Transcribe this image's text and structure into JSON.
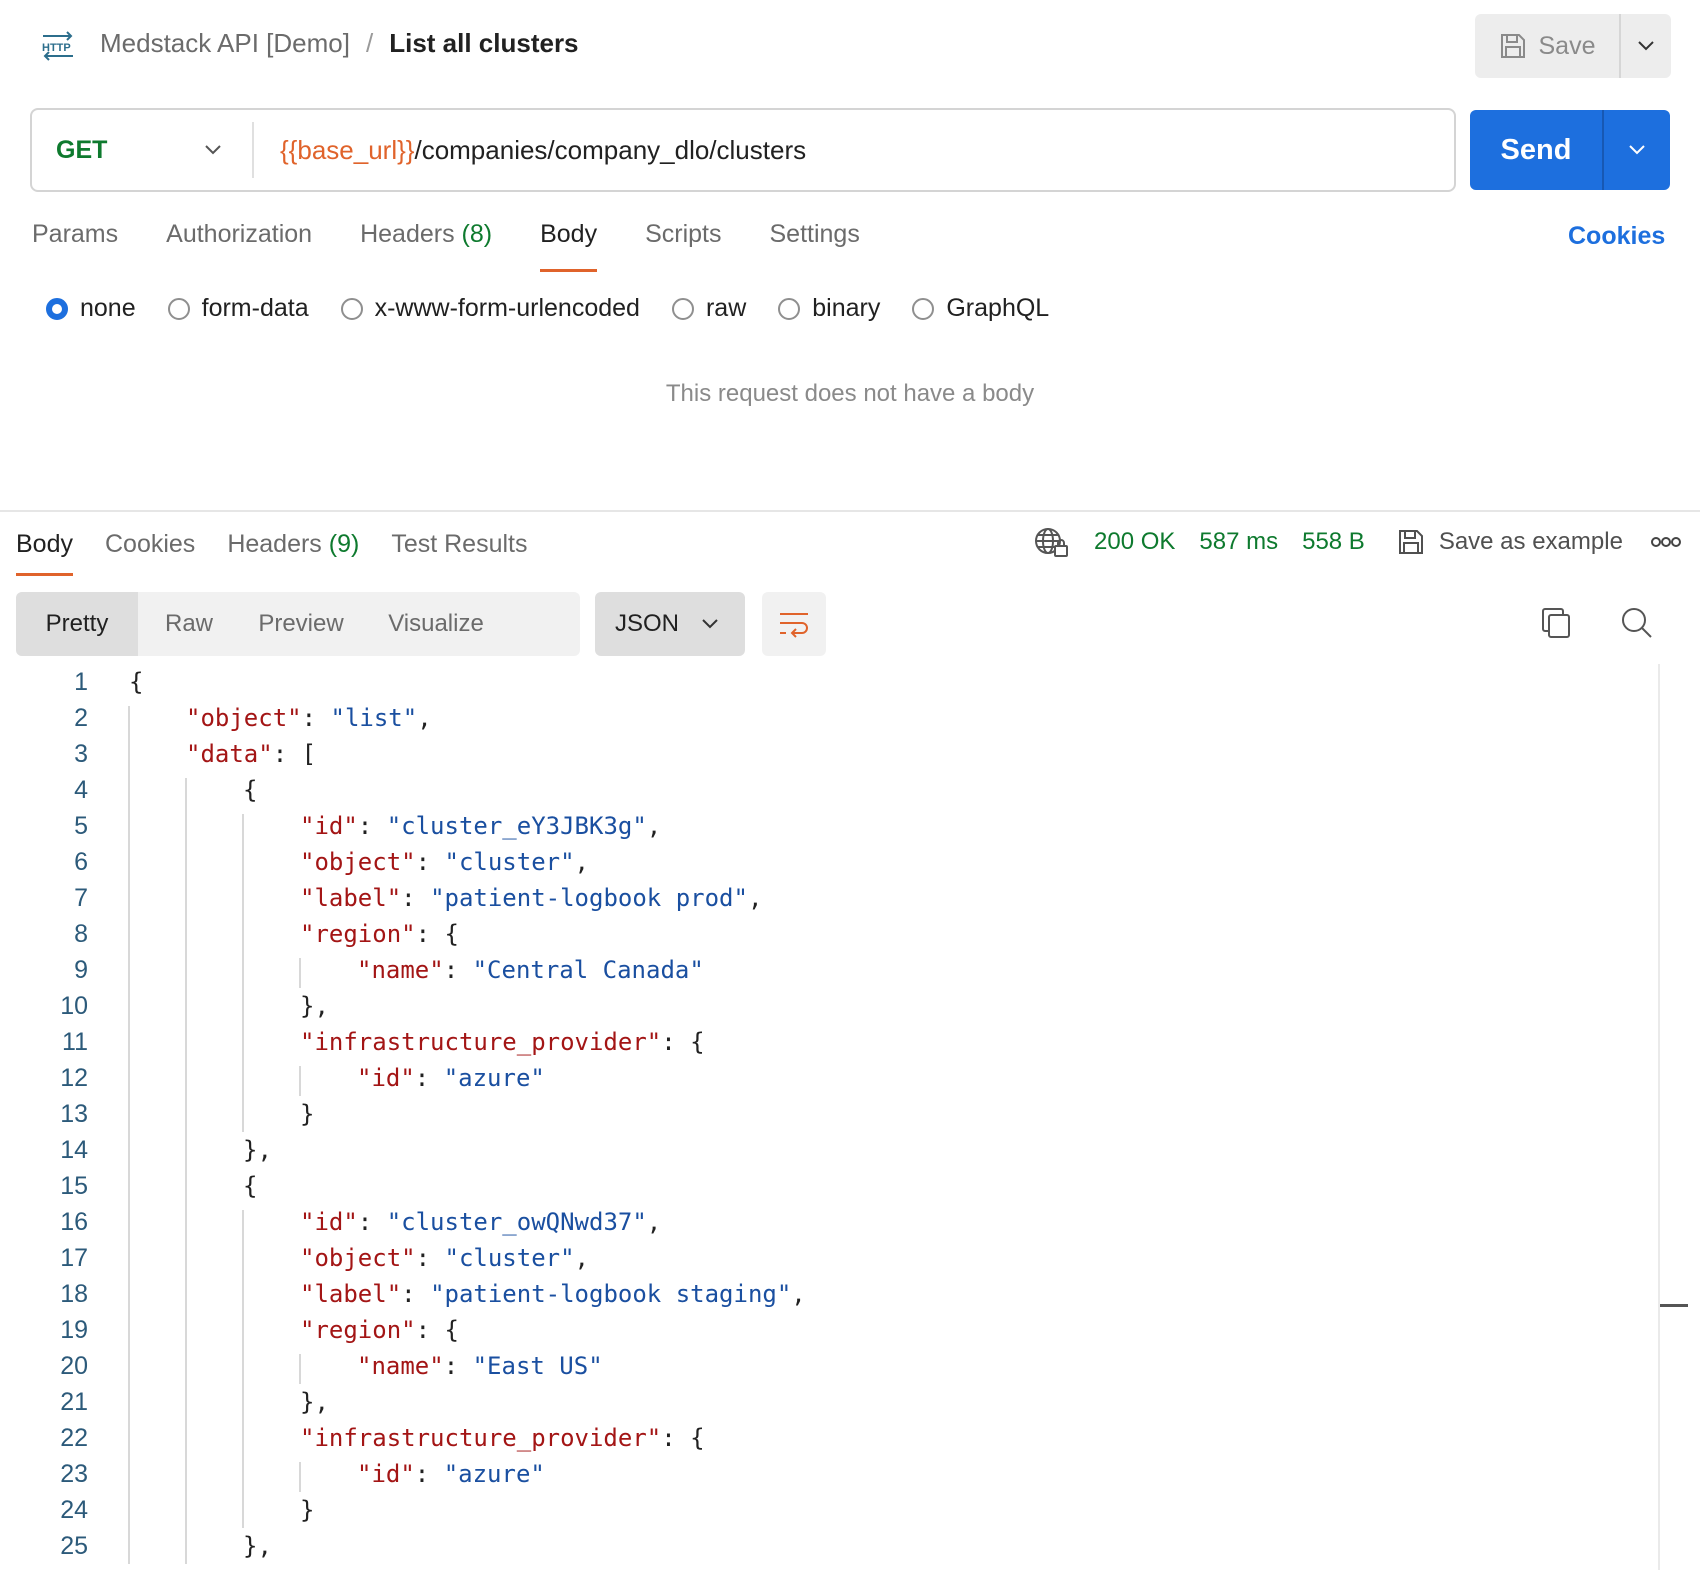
{
  "header": {
    "icon": "http-icon",
    "collection": "Medstack API [Demo]",
    "separator": "/",
    "request_name": "List all clusters",
    "save_label": "Save"
  },
  "request": {
    "method": "GET",
    "url_variable": "{{base_url}}",
    "url_path": "/companies/company_dlo/clusters",
    "send_label": "Send",
    "tabs": [
      {
        "label": "Params",
        "count": ""
      },
      {
        "label": "Authorization",
        "count": ""
      },
      {
        "label": "Headers",
        "count": "(8)"
      },
      {
        "label": "Body",
        "count": ""
      },
      {
        "label": "Scripts",
        "count": ""
      },
      {
        "label": "Settings",
        "count": ""
      }
    ],
    "active_tab": "Body",
    "cookies_link": "Cookies",
    "body_types": [
      "none",
      "form-data",
      "x-www-form-urlencoded",
      "raw",
      "binary",
      "GraphQL"
    ],
    "selected_body_type": "none",
    "empty_body_message": "This request does not have a body"
  },
  "response": {
    "tabs": [
      {
        "label": "Body",
        "count": ""
      },
      {
        "label": "Cookies",
        "count": ""
      },
      {
        "label": "Headers",
        "count": "(9)"
      },
      {
        "label": "Test Results",
        "count": ""
      }
    ],
    "active_tab": "Body",
    "status": "200 OK",
    "time": "587 ms",
    "size": "558 B",
    "save_example_label": "Save as example",
    "view_modes": [
      "Pretty",
      "Raw",
      "Preview",
      "Visualize"
    ],
    "active_view": "Pretty",
    "format": "JSON",
    "code_lines": [
      [
        {
          "t": "p",
          "v": "{"
        }
      ],
      [
        {
          "t": "k",
          "v": "\"object\""
        },
        {
          "t": "p",
          "v": ": "
        },
        {
          "t": "s",
          "v": "\"list\""
        },
        {
          "t": "p",
          "v": ","
        }
      ],
      [
        {
          "t": "k",
          "v": "\"data\""
        },
        {
          "t": "p",
          "v": ": ["
        }
      ],
      [
        {
          "t": "p",
          "v": "{"
        }
      ],
      [
        {
          "t": "k",
          "v": "\"id\""
        },
        {
          "t": "p",
          "v": ": "
        },
        {
          "t": "s",
          "v": "\"cluster_eY3JBK3g\""
        },
        {
          "t": "p",
          "v": ","
        }
      ],
      [
        {
          "t": "k",
          "v": "\"object\""
        },
        {
          "t": "p",
          "v": ": "
        },
        {
          "t": "s",
          "v": "\"cluster\""
        },
        {
          "t": "p",
          "v": ","
        }
      ],
      [
        {
          "t": "k",
          "v": "\"label\""
        },
        {
          "t": "p",
          "v": ": "
        },
        {
          "t": "s",
          "v": "\"patient-logbook prod\""
        },
        {
          "t": "p",
          "v": ","
        }
      ],
      [
        {
          "t": "k",
          "v": "\"region\""
        },
        {
          "t": "p",
          "v": ": {"
        }
      ],
      [
        {
          "t": "k",
          "v": "\"name\""
        },
        {
          "t": "p",
          "v": ": "
        },
        {
          "t": "s",
          "v": "\"Central Canada\""
        }
      ],
      [
        {
          "t": "p",
          "v": "},"
        }
      ],
      [
        {
          "t": "k",
          "v": "\"infrastructure_provider\""
        },
        {
          "t": "p",
          "v": ": {"
        }
      ],
      [
        {
          "t": "k",
          "v": "\"id\""
        },
        {
          "t": "p",
          "v": ": "
        },
        {
          "t": "s",
          "v": "\"azure\""
        }
      ],
      [
        {
          "t": "p",
          "v": "}"
        }
      ],
      [
        {
          "t": "p",
          "v": "},"
        }
      ],
      [
        {
          "t": "p",
          "v": "{"
        }
      ],
      [
        {
          "t": "k",
          "v": "\"id\""
        },
        {
          "t": "p",
          "v": ": "
        },
        {
          "t": "s",
          "v": "\"cluster_owQNwd37\""
        },
        {
          "t": "p",
          "v": ","
        }
      ],
      [
        {
          "t": "k",
          "v": "\"object\""
        },
        {
          "t": "p",
          "v": ": "
        },
        {
          "t": "s",
          "v": "\"cluster\""
        },
        {
          "t": "p",
          "v": ","
        }
      ],
      [
        {
          "t": "k",
          "v": "\"label\""
        },
        {
          "t": "p",
          "v": ": "
        },
        {
          "t": "s",
          "v": "\"patient-logbook staging\""
        },
        {
          "t": "p",
          "v": ","
        }
      ],
      [
        {
          "t": "k",
          "v": "\"region\""
        },
        {
          "t": "p",
          "v": ": {"
        }
      ],
      [
        {
          "t": "k",
          "v": "\"name\""
        },
        {
          "t": "p",
          "v": ": "
        },
        {
          "t": "s",
          "v": "\"East US\""
        }
      ],
      [
        {
          "t": "p",
          "v": "},"
        }
      ],
      [
        {
          "t": "k",
          "v": "\"infrastructure_provider\""
        },
        {
          "t": "p",
          "v": ": {"
        }
      ],
      [
        {
          "t": "k",
          "v": "\"id\""
        },
        {
          "t": "p",
          "v": ": "
        },
        {
          "t": "s",
          "v": "\"azure\""
        }
      ],
      [
        {
          "t": "p",
          "v": "}"
        }
      ],
      [
        {
          "t": "p",
          "v": "},"
        }
      ]
    ],
    "code_indents": [
      0,
      1,
      1,
      2,
      3,
      3,
      3,
      3,
      4,
      3,
      3,
      4,
      3,
      2,
      2,
      3,
      3,
      3,
      3,
      4,
      3,
      3,
      4,
      3,
      2
    ]
  },
  "colors": {
    "accent_blue": "#1d6fde",
    "method_green": "#0e7a2e",
    "variable_orange": "#e0632b",
    "json_key": "#a31515",
    "json_string": "#1a4fa0"
  }
}
